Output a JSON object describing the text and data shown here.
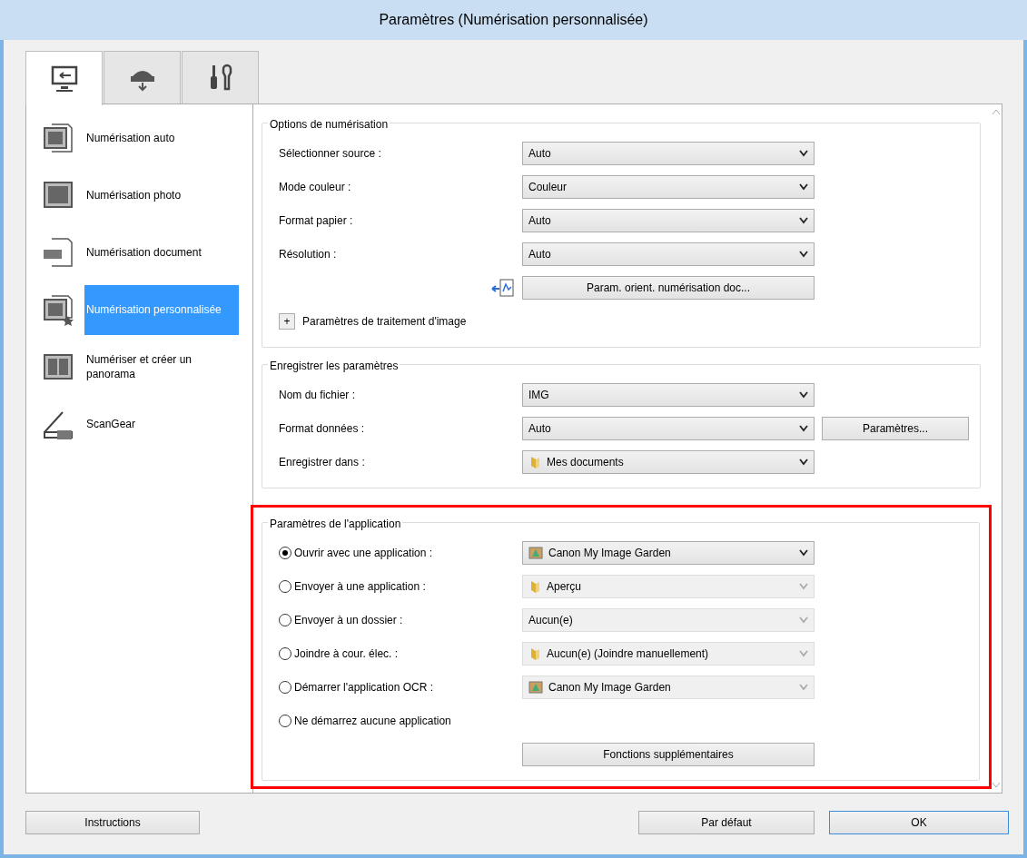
{
  "window": {
    "title": "Paramètres (Numérisation personnalisée)"
  },
  "tabs": [
    {
      "kind": "scan",
      "selected": true
    },
    {
      "kind": "save",
      "selected": false
    },
    {
      "kind": "tools",
      "selected": false
    }
  ],
  "sidebar": {
    "items": [
      {
        "kind": "auto",
        "label": "Numérisation auto",
        "selected": false
      },
      {
        "kind": "photo",
        "label": "Numérisation photo",
        "selected": false
      },
      {
        "kind": "document",
        "label": "Numérisation document",
        "selected": false
      },
      {
        "kind": "custom",
        "label": "Numérisation personnalisée",
        "selected": true
      },
      {
        "kind": "panorama",
        "label": "Numériser et créer un panorama",
        "selected": false
      },
      {
        "kind": "scangear",
        "label": "ScanGear",
        "selected": false
      }
    ]
  },
  "scan_options": {
    "title": "Options de numérisation",
    "rows": [
      {
        "label": "Sélectionner source :",
        "value": "Auto"
      },
      {
        "label": "Mode couleur :",
        "value": "Couleur"
      },
      {
        "label": "Format papier :",
        "value": "Auto"
      },
      {
        "label": "Résolution :",
        "value": "Auto"
      }
    ],
    "orientation_button": "Param. orient. numérisation doc...",
    "expand_button": "+",
    "image_processing": "Paramètres de traitement d'image"
  },
  "save_settings": {
    "title": "Enregistrer les paramètres",
    "rows": [
      {
        "label": "Nom du fichier :",
        "value": "IMG",
        "kind": "plain"
      },
      {
        "label": "Format données :",
        "value": "Auto",
        "kind": "plain",
        "button": "Paramètres..."
      },
      {
        "label": "Enregistrer dans :",
        "value": "Mes documents",
        "kind": "folder"
      }
    ]
  },
  "app_settings": {
    "title": "Paramètres de l'application",
    "highlighted": true,
    "options": [
      {
        "label": "Ouvrir avec une application :",
        "selected": true,
        "value": "Canon My Image Garden",
        "kind": "app",
        "disabled": false
      },
      {
        "label": "Envoyer à une application :",
        "selected": false,
        "value": "Aperçu",
        "kind": "folder",
        "disabled": true
      },
      {
        "label": "Envoyer à un dossier :",
        "selected": false,
        "value": "Aucun(e)",
        "kind": "plain",
        "disabled": true
      },
      {
        "label": "Joindre à cour. élec. :",
        "selected": false,
        "value": "Aucun(e) (Joindre manuellement)",
        "kind": "folder",
        "disabled": true
      },
      {
        "label": "Démarrer l'application OCR :",
        "selected": false,
        "value": "Canon My Image Garden",
        "kind": "app",
        "disabled": true
      },
      {
        "label": "Ne démarrez aucune application",
        "selected": false
      }
    ],
    "more_button": "Fonctions supplémentaires"
  },
  "footer": {
    "instructions": "Instructions",
    "default": "Par défaut",
    "ok": "OK"
  }
}
